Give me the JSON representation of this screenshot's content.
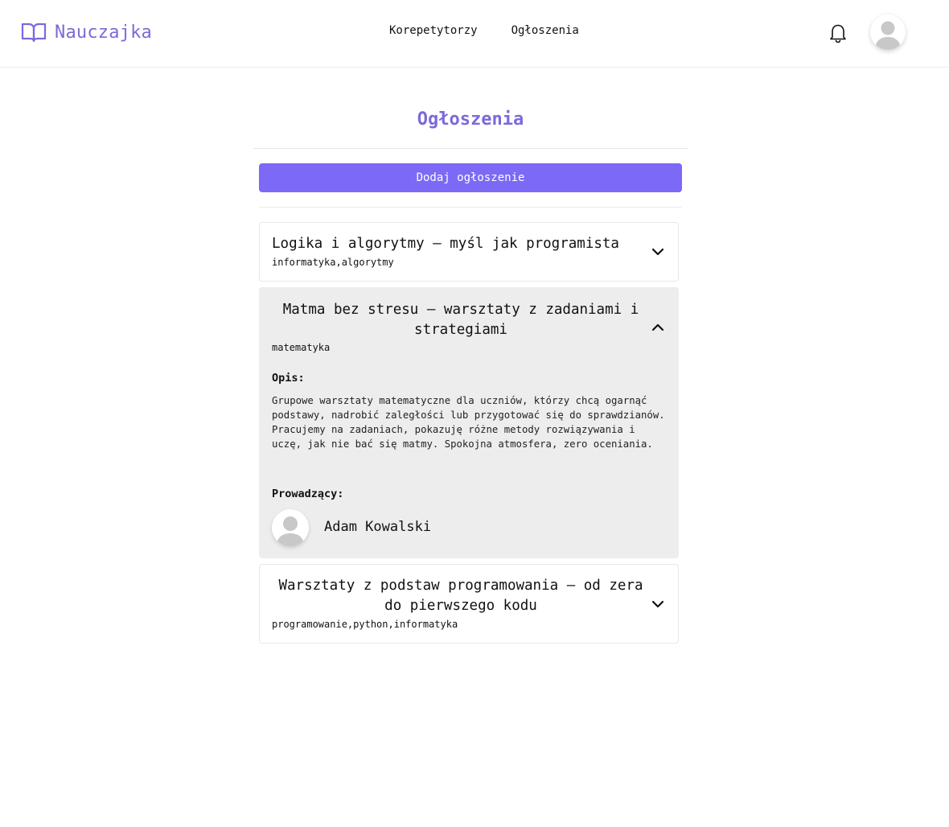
{
  "brand": {
    "name": "Nauczajka",
    "accent": "#7b6ad8"
  },
  "nav": {
    "items": [
      {
        "label": "Korepetytorzy"
      },
      {
        "label": "Ogłoszenia"
      }
    ]
  },
  "icons": {
    "logo": "book-open-icon",
    "bell": "bell-icon",
    "avatar": "user-avatar-icon",
    "chevron_down": "chevron-down-icon",
    "chevron_up": "chevron-up-icon"
  },
  "page": {
    "title": "Ogłoszenia",
    "add_button": "Dodaj ogłoszenie",
    "button_color": "#7c69f6"
  },
  "ads": [
    {
      "title": "Logika i algorytmy – myśl jak programista",
      "tags": "informatyka,algorytmy",
      "expanded": false
    },
    {
      "title": "Matma bez stresu – warsztaty z zadaniami i strategiami",
      "tags": "matematyka",
      "expanded": true,
      "description_label": "Opis:",
      "description": "Grupowe warsztaty matematyczne dla uczniów, którzy chcą ogarnąć podstawy, nadrobić zaległości lub przygotować się do sprawdzianów. Pracujemy na zadaniach, pokazuję różne metody rozwiązywania i uczę, jak nie bać się matmy. Spokojna atmosfera, zero oceniania.",
      "tutor_label": "Prowadzący:",
      "tutor_name": "Adam Kowalski"
    },
    {
      "title": "Warsztaty z podstaw programowania – od zera do pierwszego kodu",
      "tags": "programowanie,python,informatyka",
      "expanded": false
    }
  ]
}
